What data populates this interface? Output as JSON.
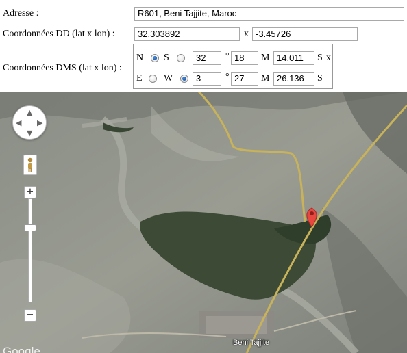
{
  "form": {
    "address_label": "Adresse :",
    "address_value": "R601, Beni Tajjite, Maroc",
    "dd_label": "Coordonnées DD (lat x lon) :",
    "dd_lat": "32.303892",
    "dd_sep": "x",
    "dd_lon": "-3.45726",
    "dms_label": "Coordonnées DMS (lat x lon) :"
  },
  "dms": {
    "lat": {
      "dir1": "N",
      "dir2": "S",
      "selected": "N",
      "deg": "32",
      "deg_sym": "°",
      "min": "18",
      "min_sym": "M",
      "sec": "14.011",
      "sec_sym": "S",
      "trail": "x"
    },
    "lon": {
      "dir1": "E",
      "dir2": "W",
      "selected": "W",
      "deg": "3",
      "deg_sym": "°",
      "min": "27",
      "min_sym": "M",
      "sec": "26.136",
      "sec_sym": "S"
    }
  },
  "map": {
    "place_label": "Beni Tajjite",
    "logo_text": "Google",
    "zoom_in": "+",
    "zoom_out": "−",
    "marker_color": "#e8473f",
    "road_color": "#c8b25a"
  }
}
